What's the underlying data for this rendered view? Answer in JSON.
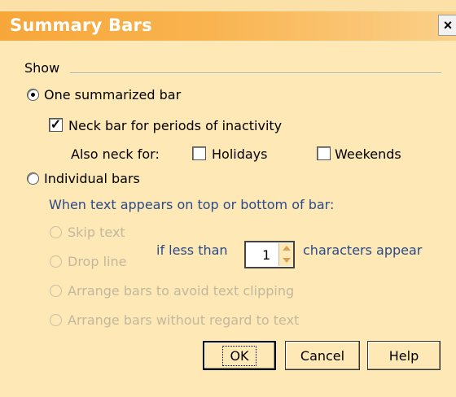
{
  "window": {
    "title": "Summary Bars",
    "close_glyph": "×"
  },
  "show_group": {
    "label": "Show",
    "one_summarized": {
      "label": "One summarized bar",
      "selected": true
    },
    "neck_bar": {
      "label": "Neck bar for periods of inactivity",
      "checked": true
    },
    "also_neck_label": "Also neck for:",
    "holidays": {
      "label": "Holidays",
      "checked": false
    },
    "weekends": {
      "label": "Weekends",
      "checked": false
    },
    "individual": {
      "label": "Individual bars",
      "selected": false
    },
    "text_position_label": "When text appears on top or bottom of bar:",
    "options": [
      {
        "label": "Skip text",
        "enabled": false
      },
      {
        "label": "Drop line",
        "enabled": false
      },
      {
        "label": "Arrange bars to avoid text clipping",
        "enabled": false
      },
      {
        "label": "Arrange bars without regard to text",
        "enabled": false
      }
    ],
    "if_less_than_label": "if less than",
    "characters_value": "1",
    "characters_appear_label": "characters appear"
  },
  "buttons": {
    "ok": "OK",
    "cancel": "Cancel",
    "help": "Help"
  }
}
